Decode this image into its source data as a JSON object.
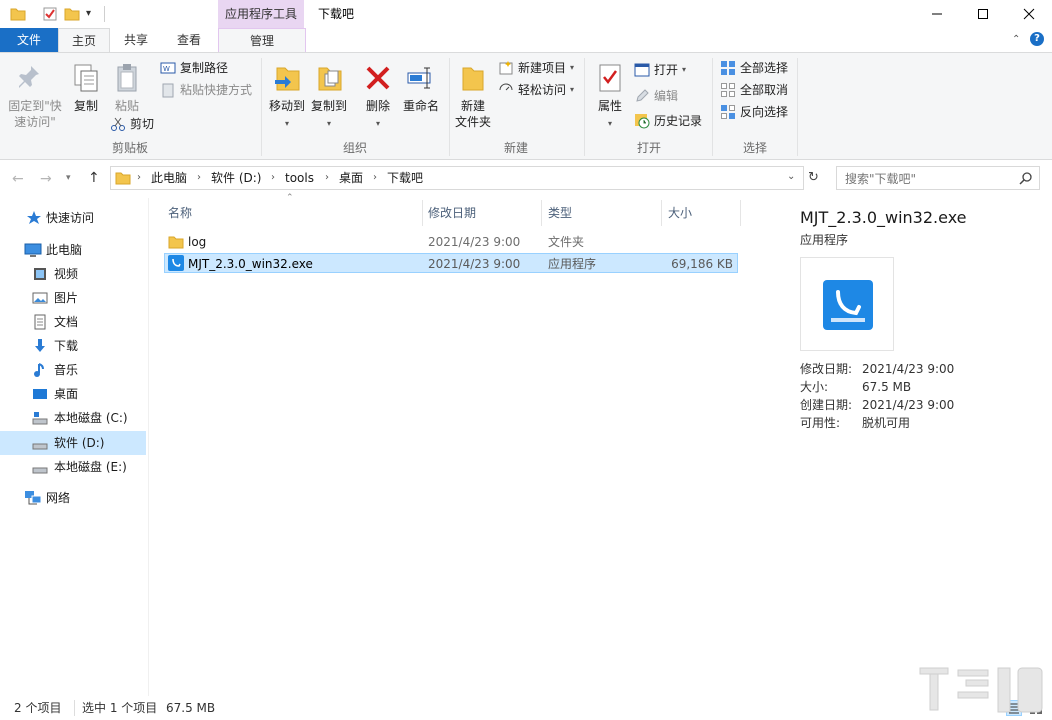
{
  "window": {
    "title": "下载吧",
    "context_tab": "应用程序工具"
  },
  "ribbon_tabs": {
    "file": "文件",
    "home": "主页",
    "share": "共享",
    "view": "查看",
    "manage": "管理"
  },
  "ribbon": {
    "clipboard": {
      "pin_line1": "固定到\"快",
      "pin_line2": "速访问\"",
      "copy": "复制",
      "paste": "粘贴",
      "copy_path": "复制路径",
      "paste_shortcut": "粘贴快捷方式",
      "cut": "剪切",
      "label": "剪贴板"
    },
    "organize": {
      "move_to": "移动到",
      "copy_to": "复制到",
      "delete": "删除",
      "rename": "重命名",
      "label": "组织"
    },
    "new": {
      "new_folder_line1": "新建",
      "new_folder_line2": "文件夹",
      "new_item": "新建项目",
      "easy_access": "轻松访问",
      "label": "新建"
    },
    "open": {
      "properties": "属性",
      "open": "打开",
      "edit": "编辑",
      "history": "历史记录",
      "label": "打开"
    },
    "select": {
      "select_all": "全部选择",
      "select_none": "全部取消",
      "invert": "反向选择",
      "label": "选择"
    }
  },
  "breadcrumb": [
    "此电脑",
    "软件 (D:)",
    "tools",
    "桌面",
    "下载吧"
  ],
  "search": {
    "placeholder": "搜索\"下载吧\""
  },
  "nav": {
    "quick_access": "快速访问",
    "this_pc": "此电脑",
    "videos": "视频",
    "pictures": "图片",
    "documents": "文档",
    "downloads": "下载",
    "music": "音乐",
    "desktop": "桌面",
    "drive_c": "本地磁盘 (C:)",
    "drive_d": "软件 (D:)",
    "drive_e": "本地磁盘 (E:)",
    "network": "网络"
  },
  "columns": {
    "name": "名称",
    "modified": "修改日期",
    "type": "类型",
    "size": "大小"
  },
  "files": [
    {
      "name": "log",
      "modified": "2021/4/23 9:00",
      "type": "文件夹",
      "size": ""
    },
    {
      "name": "MJT_2.3.0_win32.exe",
      "modified": "2021/4/23 9:00",
      "type": "应用程序",
      "size": "69,186 KB"
    }
  ],
  "preview": {
    "filename": "MJT_2.3.0_win32.exe",
    "filetype": "应用程序",
    "modified_label": "修改日期:",
    "modified_value": "2021/4/23 9:00",
    "size_label": "大小:",
    "size_value": "67.5 MB",
    "created_label": "创建日期:",
    "created_value": "2021/4/23 9:00",
    "availability_label": "可用性:",
    "availability_value": "脱机可用"
  },
  "status": {
    "item_count": "2 个项目",
    "selected": "选中 1 个项目",
    "selected_size": "67.5 MB"
  },
  "colors": {
    "accent": "#1a6fc6",
    "selection": "#cce8ff",
    "context_tab": "#e9d6f2"
  }
}
